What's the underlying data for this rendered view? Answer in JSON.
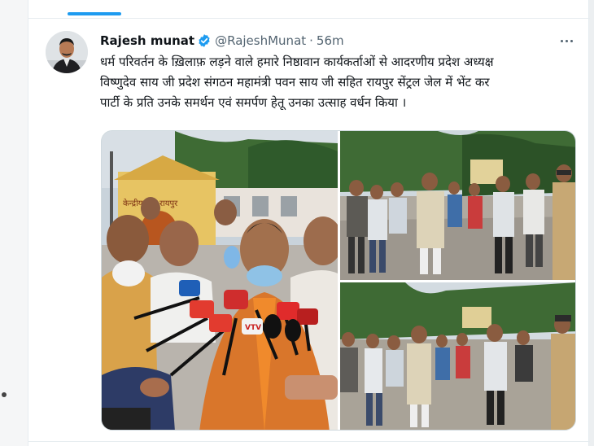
{
  "tweet": {
    "author": {
      "display_name": "Rajesh munat",
      "handle": "@RajeshMunat",
      "verified": true,
      "avatar_icon": "profile-photo"
    },
    "separator": "·",
    "time": "56m",
    "text_lines": [
      "धर्म परिवर्तन के ख़िलाफ़ लड़ने वाले हमारे निष्ठावान कार्यकर्ताओं से आदरणीय प्रदेश अध्यक्ष",
      "विष्णुदेव साय जी प्रदेश संगठन महामंत्री पवन साय जी सहित रायपुर सेंट्रल जेल में भेंट कर",
      "पार्टी के प्रति उनके समर्थन एवं समर्पण हेतू उनका उत्साह वर्धन किया ।"
    ],
    "media": [
      {
        "sign_text": "केन्द्रीय जेल रायपुर",
        "mic_brand": "VTV"
      },
      {},
      {}
    ]
  },
  "colors": {
    "accent": "#1d9bf0",
    "text_primary": "#0f1419",
    "text_secondary": "#536471",
    "saffron": "#e8792a"
  },
  "icons": {
    "verified": "verified-badge-icon",
    "more": "more-options-icon"
  }
}
